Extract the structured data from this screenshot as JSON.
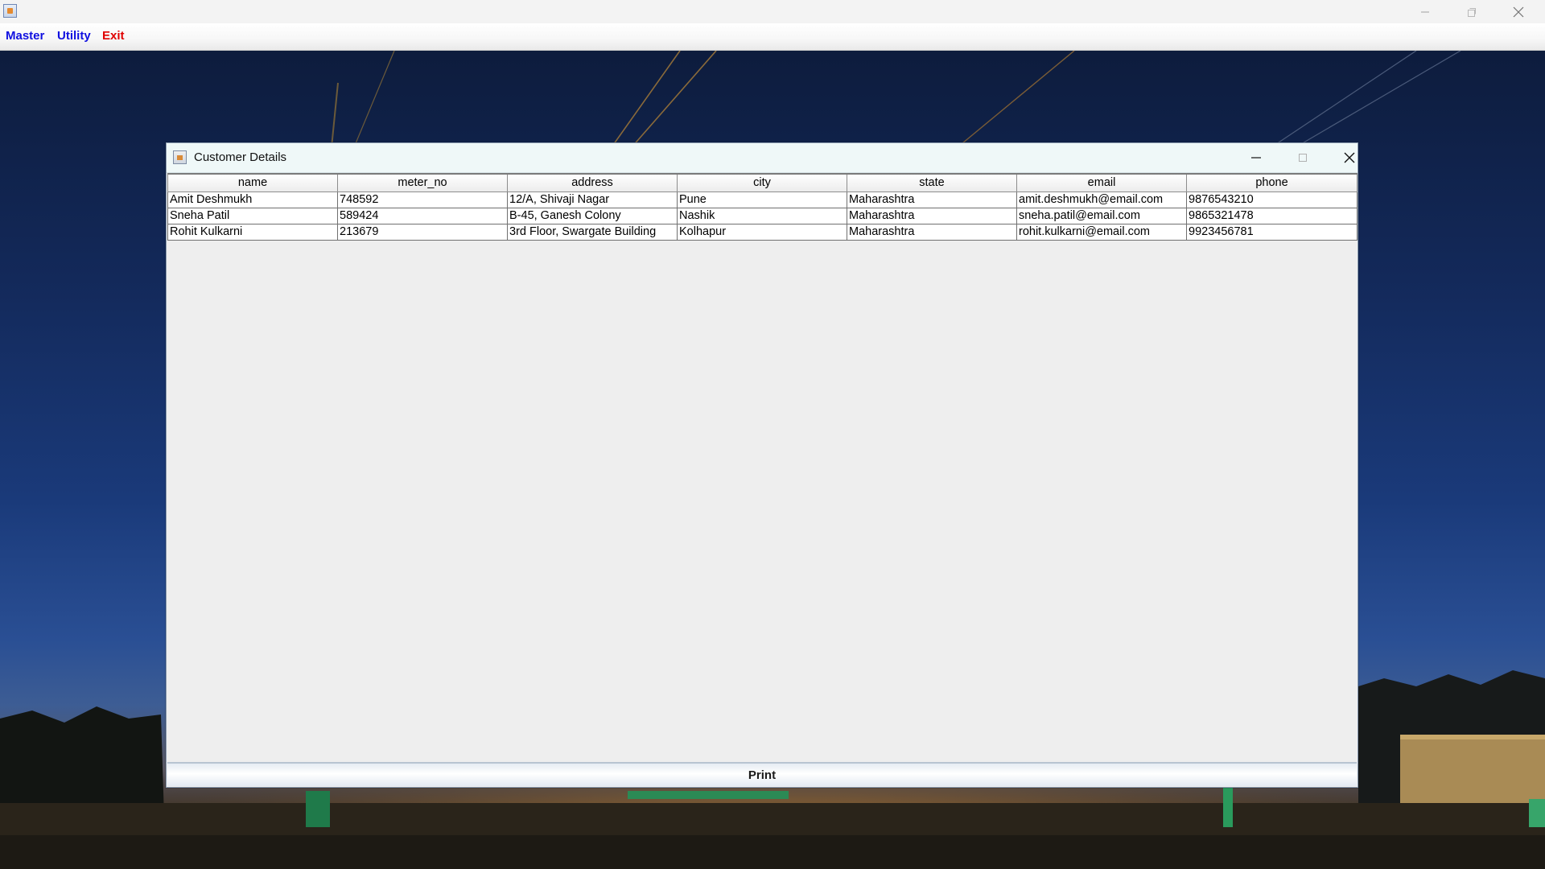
{
  "colors": {
    "menu_blue": "#0000ff",
    "menu_red": "#ff0000"
  },
  "menubar": {
    "items": [
      {
        "label": "Master",
        "color": "#1010e0"
      },
      {
        "label": "Utility",
        "color": "#1010e0"
      },
      {
        "label": "Exit",
        "color": "#e00000"
      }
    ]
  },
  "window": {
    "icon": "java-cup-icon",
    "controls": [
      "minimize-icon",
      "maximize-icon",
      "close-icon"
    ]
  },
  "dialog": {
    "title": "Customer Details",
    "icon": "java-cup-icon",
    "controls": [
      "minimize-icon",
      "maximize-icon",
      "close-icon"
    ]
  },
  "table": {
    "columns": [
      "name",
      "meter_no",
      "address",
      "city",
      "state",
      "email",
      "phone"
    ],
    "rows": [
      [
        "Amit Deshmukh",
        "748592",
        "12/A, Shivaji Nagar",
        "Pune",
        "Maharashtra",
        "amit.deshmukh@email.com",
        "9876543210"
      ],
      [
        "Sneha Patil",
        "589424",
        "B-45, Ganesh Colony",
        "Nashik",
        "Maharashtra",
        "sneha.patil@email.com",
        "9865321478"
      ],
      [
        "Rohit Kulkarni",
        "213679",
        "3rd Floor, Swargate Building",
        "Kolhapur",
        "Maharashtra",
        "rohit.kulkarni@email.com",
        "9923456781"
      ]
    ]
  },
  "footer": {
    "print_label": "Print"
  }
}
